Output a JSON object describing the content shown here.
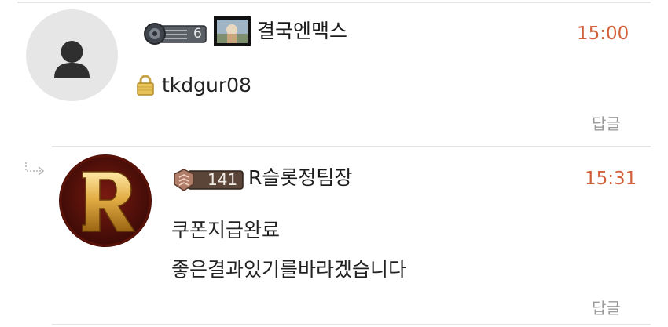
{
  "colors": {
    "time": "#d2603a",
    "reply": "#9a9a9a",
    "divider": "#e4e4e4"
  },
  "comments": [
    {
      "nickname": "결국엔맥스",
      "level_badge": "6",
      "time": "15:00",
      "locked_icon": "lock-icon",
      "text": "tkdgur08",
      "reply_label": "답글"
    },
    {
      "nickname": "R슬롯정팀장",
      "level_badge": "141",
      "time": "15:31",
      "lines": [
        "쿠폰지급완료",
        "좋은결과있기를바라겠습니다"
      ],
      "reply_label": "답글",
      "reply_indicator_icon": "reply-arrow-icon"
    }
  ]
}
